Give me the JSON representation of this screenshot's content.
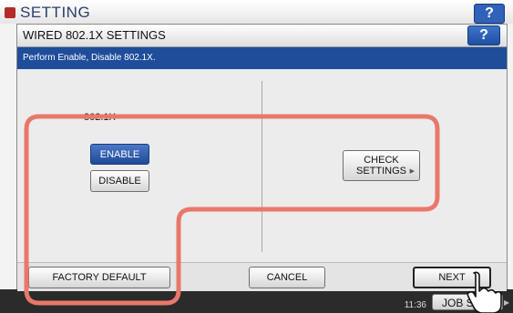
{
  "background": {
    "title": "SETTING",
    "help_label": "?",
    "clock": "11:36",
    "jobs_label": "JOB S"
  },
  "dialog": {
    "title": "WIRED 802.1X SETTINGS",
    "help_label": "?",
    "instruction": "Perform Enable, Disable 802.1X.",
    "setting_label": "802.1X",
    "enable_label": "ENABLE",
    "disable_label": "DISABLE",
    "check_label_line1": "CHECK",
    "check_label_line2": "SETTINGS",
    "factory_default_label": "FACTORY DEFAULT",
    "cancel_label": "CANCEL",
    "next_label": "NEXT",
    "selected_option": "ENABLE"
  },
  "colors": {
    "banner": "#1f4d9a",
    "selected_button": "#1e4a96",
    "highlight_outline": "#e9786a"
  },
  "icons": {
    "more_arrow": "triangle-right-icon",
    "pointer": "hand-pointer-icon"
  }
}
